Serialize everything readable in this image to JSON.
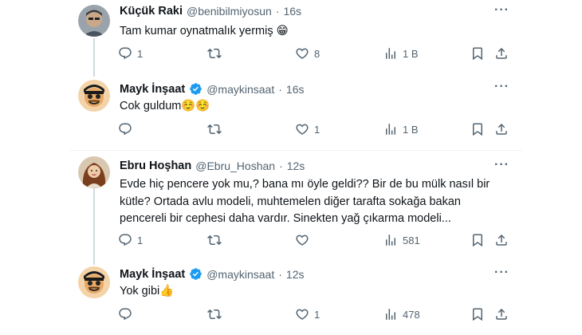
{
  "tweets": [
    {
      "name": "Küçük Raki",
      "handle": "@benibilmiyosun",
      "sep": "·",
      "time": "16s",
      "verified": false,
      "text": "Tam kumar oynatmalık yermiş 😁",
      "replies": "1",
      "retweets": "",
      "likes": "8",
      "views": "1 B"
    },
    {
      "name": "Mayk İnşaat",
      "handle": "@maykinsaat",
      "sep": "·",
      "time": "16s",
      "verified": true,
      "text": "Cok guldum☺️☺️",
      "replies": "",
      "retweets": "",
      "likes": "1",
      "views": "1 B"
    },
    {
      "name": "Ebru Hoşhan",
      "handle": "@Ebru_Hoshan",
      "sep": "·",
      "time": "12s",
      "verified": false,
      "text": "Evde hiç pencere yok mu,? bana mı öyle geldi?? Bir de bu mülk nasıl bir kütle? Ortada avlu modeli, muhtemelen diğer tarafta sokağa bakan pencereli bir cephesi daha vardır. Sinekten yağ çıkarma modeli...",
      "replies": "1",
      "retweets": "",
      "likes": "",
      "views": "581"
    },
    {
      "name": "Mayk İnşaat",
      "handle": "@maykinsaat",
      "sep": "·",
      "time": "12s",
      "verified": true,
      "text": "Yok gibi👍",
      "replies": "",
      "retweets": "",
      "likes": "1",
      "views": "478"
    }
  ],
  "icons": {
    "more": "more-icon",
    "reply": "reply-icon",
    "retweet": "retweet-icon",
    "like": "heart-icon",
    "views": "views-icon",
    "bookmark": "bookmark-icon",
    "share": "share-icon",
    "verified": "verified-badge-icon"
  },
  "colors": {
    "text": "#0f1419",
    "secondary": "#536471",
    "verified": "#1d9bf0",
    "divider": "#eff3f4",
    "thread_line": "#cfd9de"
  }
}
